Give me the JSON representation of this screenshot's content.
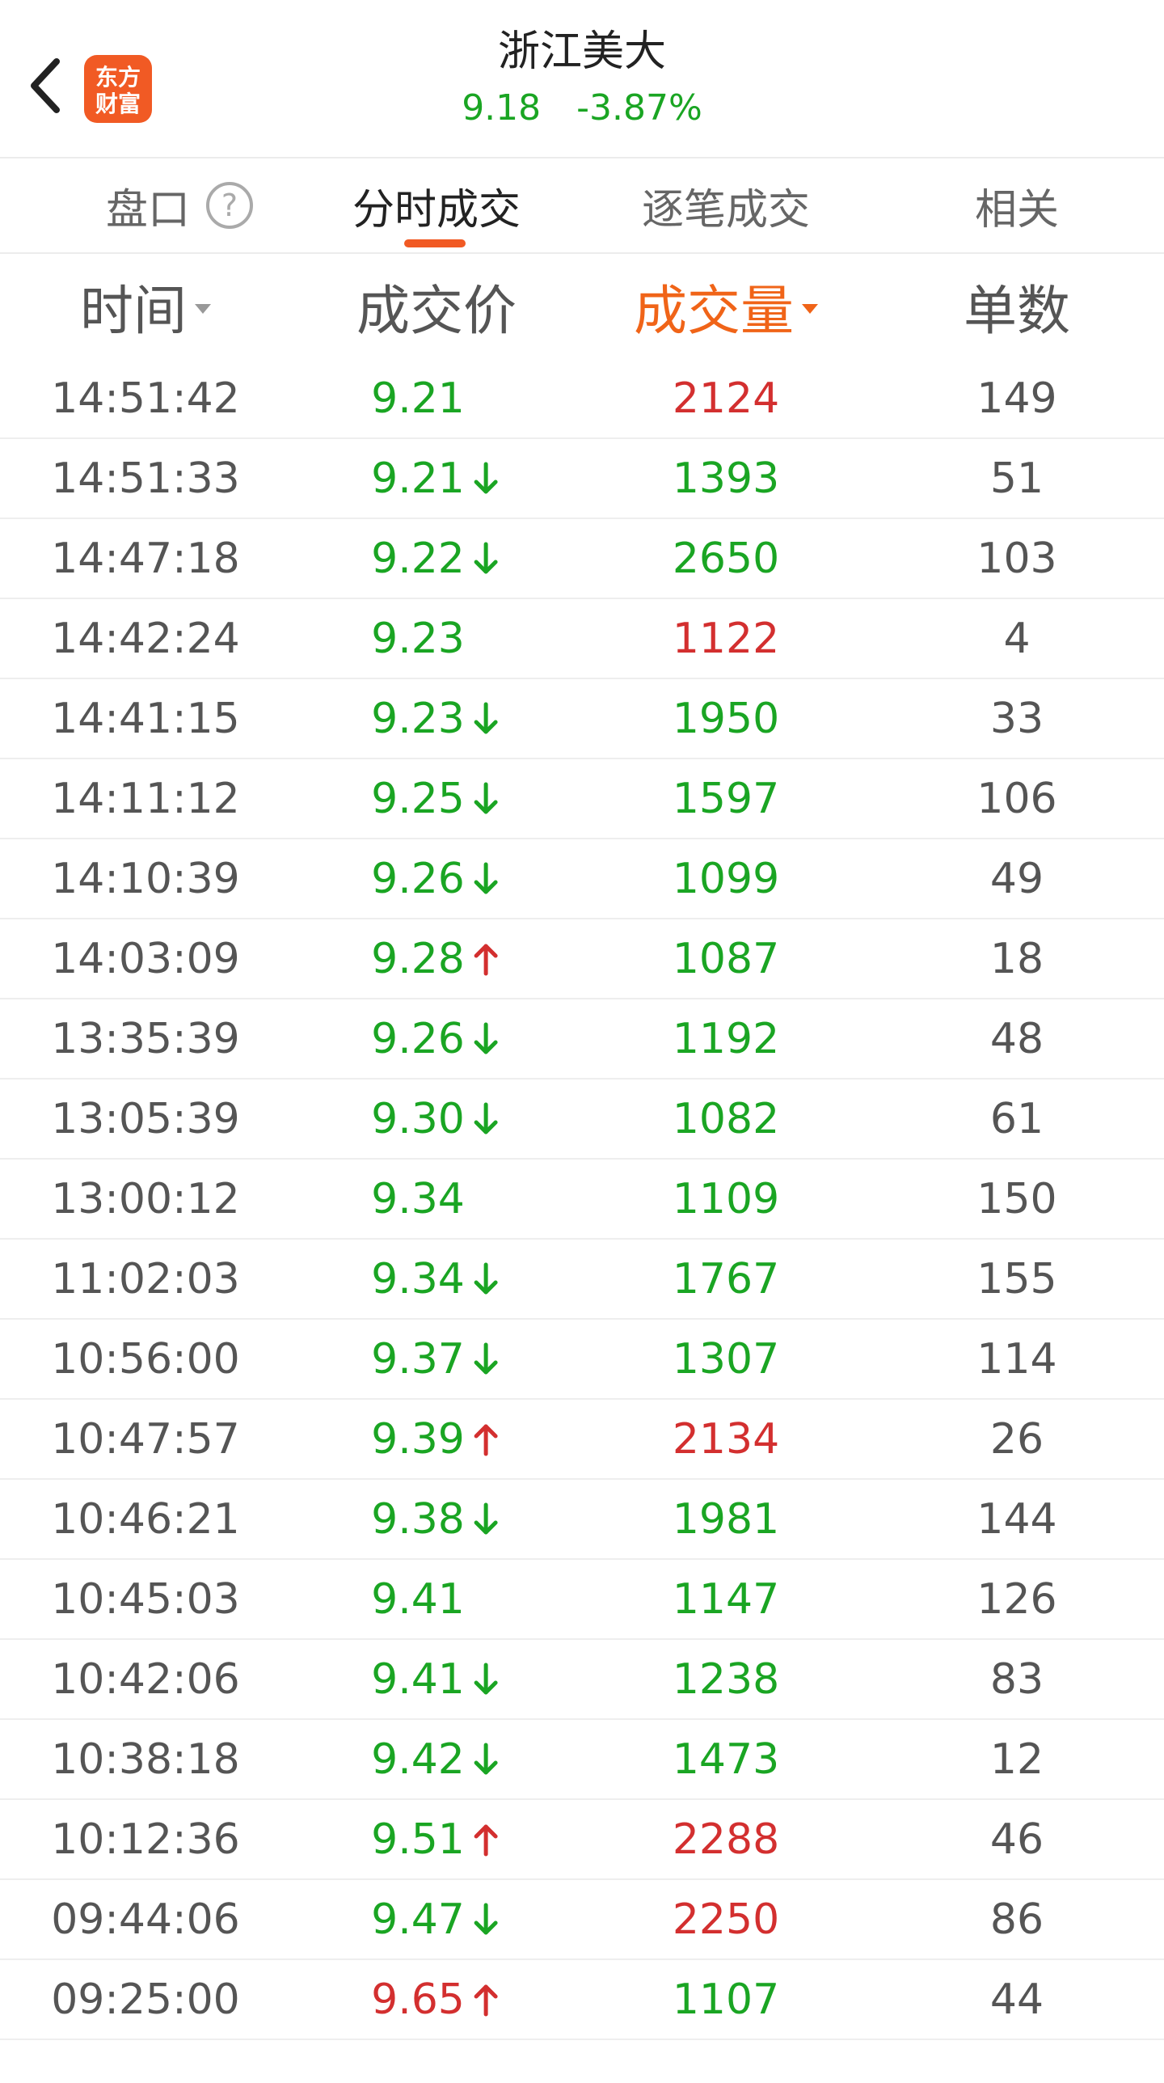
{
  "header": {
    "back_icon": "chevron-left-icon",
    "logo_line1": "东方",
    "logo_line2": "财富",
    "stock_name": "浙江美大",
    "price": "9.18",
    "change_pct": "-3.87%",
    "quote_color": "#1aa523"
  },
  "tabs": {
    "pankou": "盘口",
    "help_icon": "question-circle-icon",
    "fenshi": "分时成交",
    "zhubi": "逐笔成交",
    "related": "相关",
    "active": "分时成交",
    "accent_color": "#f15a24"
  },
  "columns": {
    "time": "时间",
    "price": "成交价",
    "volume": "成交量",
    "count": "单数",
    "sorted_by": "成交量"
  },
  "colors": {
    "up": "#d32f2f",
    "down": "#1aa523",
    "sort_highlight": "#f06418"
  },
  "rows": [
    {
      "time": "14:51:42",
      "price": "9.21",
      "price_color": "green",
      "dir": "",
      "volume": "2124",
      "volume_color": "red",
      "count": "149"
    },
    {
      "time": "14:51:33",
      "price": "9.21",
      "price_color": "green",
      "dir": "down",
      "volume": "1393",
      "volume_color": "green",
      "count": "51"
    },
    {
      "time": "14:47:18",
      "price": "9.22",
      "price_color": "green",
      "dir": "down",
      "volume": "2650",
      "volume_color": "green",
      "count": "103"
    },
    {
      "time": "14:42:24",
      "price": "9.23",
      "price_color": "green",
      "dir": "",
      "volume": "1122",
      "volume_color": "red",
      "count": "4"
    },
    {
      "time": "14:41:15",
      "price": "9.23",
      "price_color": "green",
      "dir": "down",
      "volume": "1950",
      "volume_color": "green",
      "count": "33"
    },
    {
      "time": "14:11:12",
      "price": "9.25",
      "price_color": "green",
      "dir": "down",
      "volume": "1597",
      "volume_color": "green",
      "count": "106"
    },
    {
      "time": "14:10:39",
      "price": "9.26",
      "price_color": "green",
      "dir": "down",
      "volume": "1099",
      "volume_color": "green",
      "count": "49"
    },
    {
      "time": "14:03:09",
      "price": "9.28",
      "price_color": "green",
      "dir": "up",
      "volume": "1087",
      "volume_color": "green",
      "count": "18"
    },
    {
      "time": "13:35:39",
      "price": "9.26",
      "price_color": "green",
      "dir": "down",
      "volume": "1192",
      "volume_color": "green",
      "count": "48"
    },
    {
      "time": "13:05:39",
      "price": "9.30",
      "price_color": "green",
      "dir": "down",
      "volume": "1082",
      "volume_color": "green",
      "count": "61"
    },
    {
      "time": "13:00:12",
      "price": "9.34",
      "price_color": "green",
      "dir": "",
      "volume": "1109",
      "volume_color": "green",
      "count": "150"
    },
    {
      "time": "11:02:03",
      "price": "9.34",
      "price_color": "green",
      "dir": "down",
      "volume": "1767",
      "volume_color": "green",
      "count": "155"
    },
    {
      "time": "10:56:00",
      "price": "9.37",
      "price_color": "green",
      "dir": "down",
      "volume": "1307",
      "volume_color": "green",
      "count": "114"
    },
    {
      "time": "10:47:57",
      "price": "9.39",
      "price_color": "green",
      "dir": "up",
      "volume": "2134",
      "volume_color": "red",
      "count": "26"
    },
    {
      "time": "10:46:21",
      "price": "9.38",
      "price_color": "green",
      "dir": "down",
      "volume": "1981",
      "volume_color": "green",
      "count": "144"
    },
    {
      "time": "10:45:03",
      "price": "9.41",
      "price_color": "green",
      "dir": "",
      "volume": "1147",
      "volume_color": "green",
      "count": "126"
    },
    {
      "time": "10:42:06",
      "price": "9.41",
      "price_color": "green",
      "dir": "down",
      "volume": "1238",
      "volume_color": "green",
      "count": "83"
    },
    {
      "time": "10:38:18",
      "price": "9.42",
      "price_color": "green",
      "dir": "down",
      "volume": "1473",
      "volume_color": "green",
      "count": "12"
    },
    {
      "time": "10:12:36",
      "price": "9.51",
      "price_color": "green",
      "dir": "up",
      "volume": "2288",
      "volume_color": "red",
      "count": "46"
    },
    {
      "time": "09:44:06",
      "price": "9.47",
      "price_color": "green",
      "dir": "down",
      "volume": "2250",
      "volume_color": "red",
      "count": "86"
    },
    {
      "time": "09:25:00",
      "price": "9.65",
      "price_color": "red",
      "dir": "up",
      "volume": "1107",
      "volume_color": "green",
      "count": "44"
    }
  ]
}
